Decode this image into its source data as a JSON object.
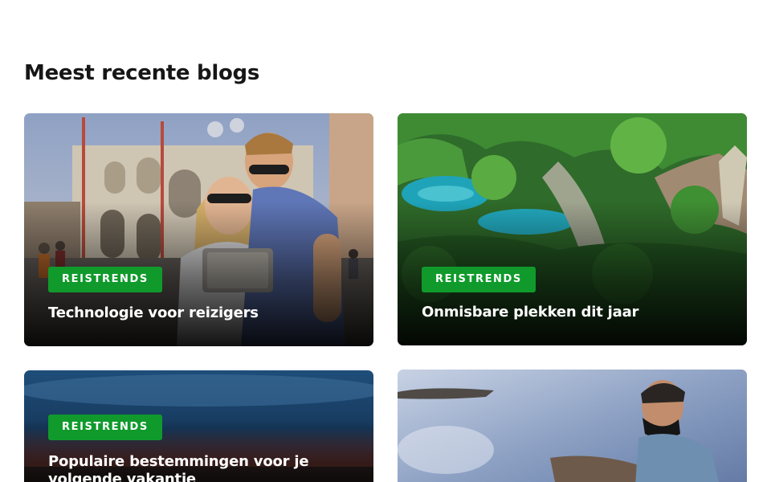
{
  "section": {
    "title": "Meest recente blogs"
  },
  "cards": [
    {
      "category": "REISTRENDS",
      "title": "Technologie voor reizigers",
      "image": "couple-with-tablet-venice-photo"
    },
    {
      "category": "REISTRENDS",
      "title": "Onmisbare plekken dit jaar",
      "image": "turquoise-lakes-forest-photo"
    },
    {
      "category": "REISTRENDS",
      "title": "Populaire bestemmingen voor je volgende vakantie",
      "image": "sunset-beach-photo"
    },
    {
      "image": "man-with-mask-by-sea-photo"
    }
  ],
  "colors": {
    "badge": "#109a2c",
    "heading": "#161616"
  }
}
